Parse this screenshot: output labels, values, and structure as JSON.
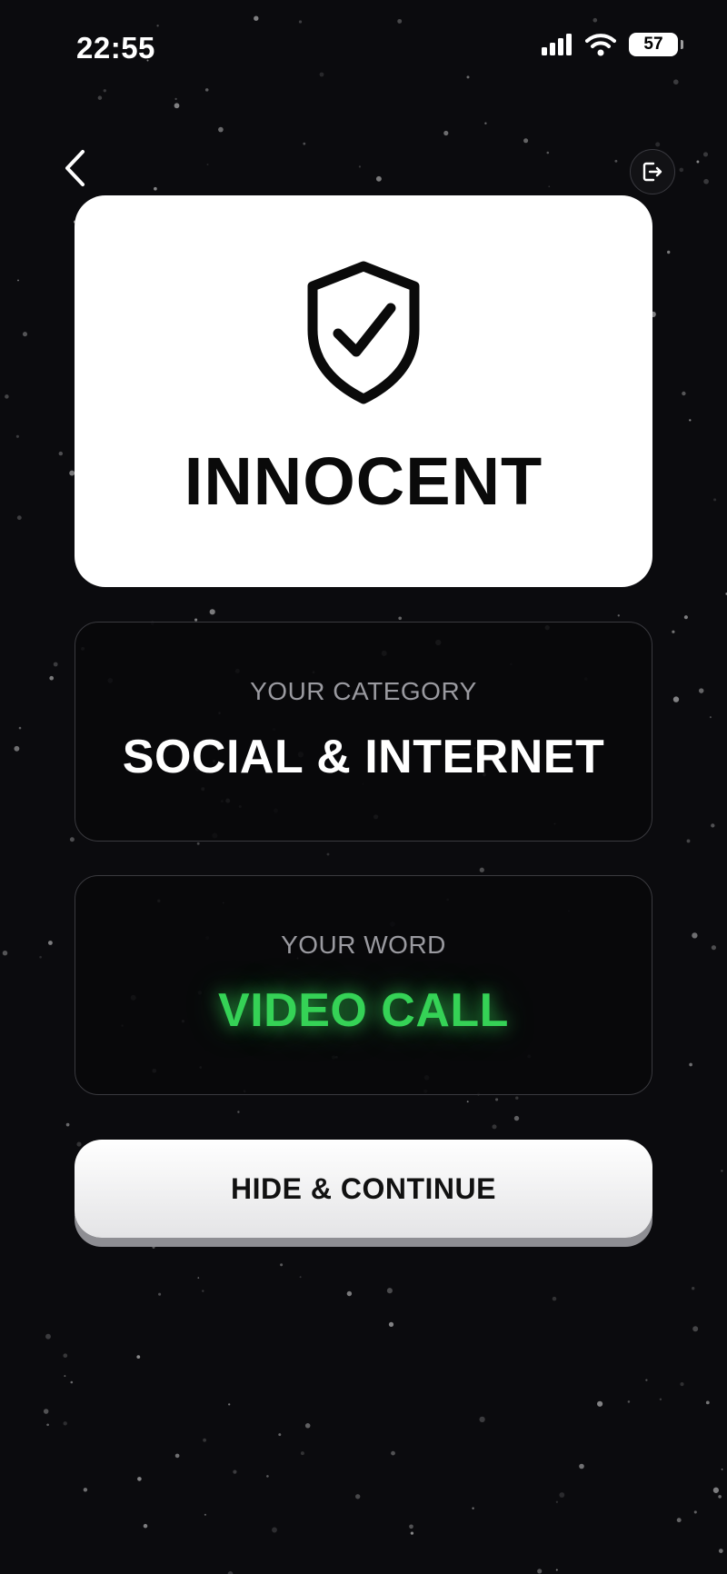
{
  "status_bar": {
    "time": "22:55",
    "battery": "57"
  },
  "nav": {
    "back_icon": "chevron-left-icon",
    "exit_icon": "exit-icon"
  },
  "role_card": {
    "icon": "shield-check-icon",
    "title": "INNOCENT"
  },
  "category": {
    "label": "YOUR CATEGORY",
    "value": "SOCIAL & INTERNET"
  },
  "word": {
    "label": "YOUR WORD",
    "value": "VIDEO CALL",
    "color": "#35d256"
  },
  "actions": {
    "continue_label": "HIDE & CONTINUE"
  },
  "colors": {
    "background": "#0b0b0e",
    "card": "#ffffff",
    "accent_green": "#35d256"
  }
}
